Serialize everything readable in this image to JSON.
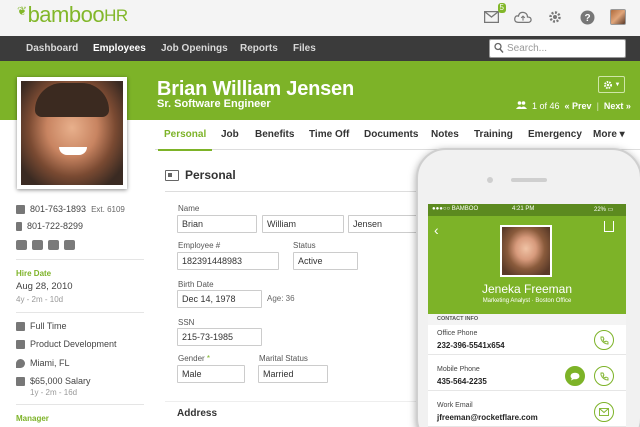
{
  "brand": {
    "logo_bamboo": "bamboo",
    "logo_hr": "HR",
    "accent": "#7db328"
  },
  "topbar": {
    "inbox_count": "5",
    "icons": [
      "inbox-icon",
      "cloud-icon",
      "gear-icon",
      "help-icon",
      "user-avatar"
    ]
  },
  "nav": {
    "items": [
      "Dashboard",
      "Employees",
      "Job Openings",
      "Reports",
      "Files"
    ],
    "active": "Employees",
    "search_placeholder": "Search..."
  },
  "employee": {
    "name": "Brian William Jensen",
    "title": "Sr. Software Engineer",
    "pager": {
      "position": "1 of 46",
      "prev": "« Prev",
      "next": "Next »"
    }
  },
  "tabs": [
    "Personal",
    "Job",
    "Benefits",
    "Time Off",
    "Documents",
    "Notes",
    "Training",
    "Emergency",
    "More ▾"
  ],
  "sidebar": {
    "work_phone": "801-763-1893",
    "ext": "Ext. 6109",
    "mobile_phone": "801-722-8299",
    "hire_date_label": "Hire Date",
    "hire_date": "Aug 28, 2010",
    "hire_tenure": "4y - 2m - 10d",
    "employment": "Full Time",
    "department": "Product Development",
    "location": "Miami, FL",
    "salary": "$65,000 Salary",
    "salary_duration": "1y - 2m - 16d",
    "manager_label": "Manager"
  },
  "personal": {
    "section_title": "Personal",
    "name_label": "Name",
    "first": "Brian",
    "middle": "William",
    "last": "Jensen",
    "employee_num_label": "Employee #",
    "employee_num": "182391448983",
    "status_label": "Status",
    "status": "Active",
    "birth_label": "Birth Date",
    "birth": "Dec 14, 1978",
    "age": "Age: 36",
    "ssn_label": "SSN",
    "ssn": "215-73-1985",
    "gender_label": "Gender",
    "gender_req": "*",
    "gender": "Male",
    "marital_label": "Marital Status",
    "marital": "Married",
    "address_title": "Address"
  },
  "phone_app": {
    "status_carrier": "●●●○○ BAMBOO",
    "status_time": "4:21 PM",
    "status_battery": "22% ▭",
    "name": "Jeneka Freeman",
    "role": "Marketing Analyst · Boston Office",
    "section": "CONTACT INFO",
    "rows": [
      {
        "label": "Office Phone",
        "value": "232-396-5541x654"
      },
      {
        "label": "Mobile Phone",
        "value": "435-564-2235"
      },
      {
        "label": "Work Email",
        "value": "jfreeman@rocketflare.com"
      }
    ]
  }
}
